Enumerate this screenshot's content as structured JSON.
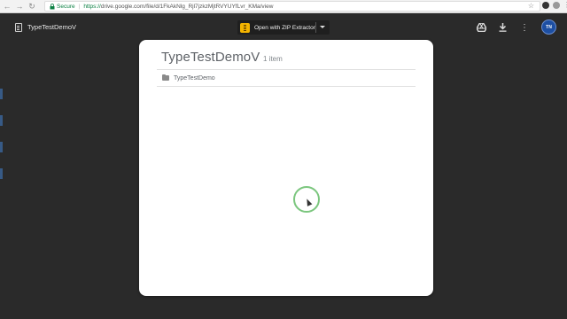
{
  "browser": {
    "secure_label": "Secure",
    "url_scheme": "https://",
    "url_rest": "drive.google.com/file/d/1FkAkNlg_Rjl7jzkzMjtRVYUYfLvr_KMa/view"
  },
  "viewer": {
    "doc_title": "TypeTestDemoV",
    "open_with_label": "Open with ZIP Extractor",
    "avatar_initials": "TN"
  },
  "folder": {
    "title": "TypeTestDemoV",
    "item_count": "1 item",
    "items": [
      {
        "name": "TypeTestDemo",
        "icon": "folder-icon"
      }
    ]
  },
  "colors": {
    "secure_green": "#0b8043",
    "cursor_ring": "#7bc67e",
    "zip_yellow": "#f4b400",
    "avatar_blue": "#1d4fa3"
  }
}
